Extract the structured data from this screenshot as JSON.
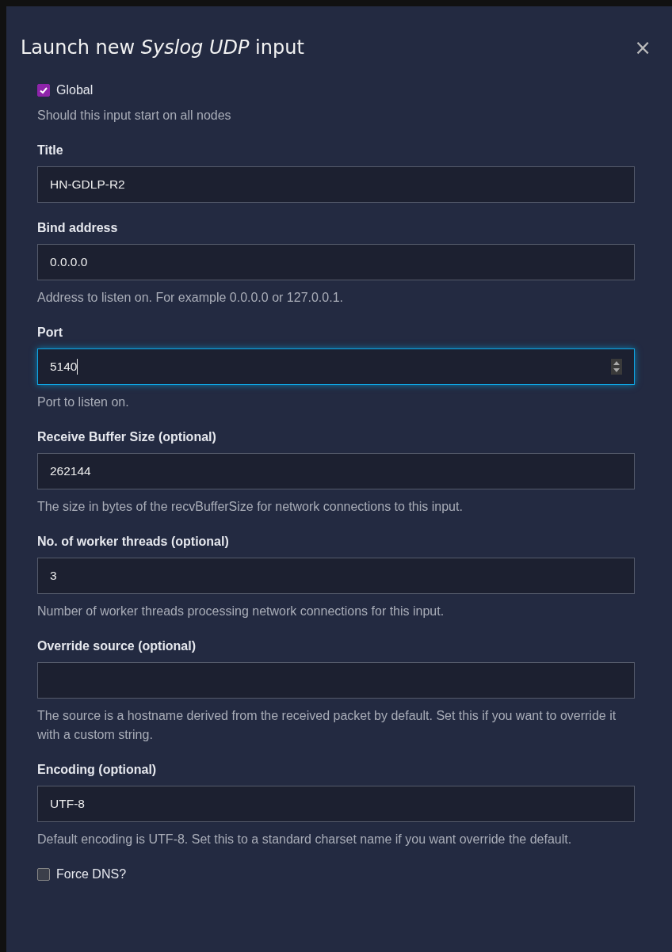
{
  "dialog": {
    "title": "Launch new *Syslog UDP* input",
    "close": "×"
  },
  "fields": [
    {
      "kind": "checkbox",
      "label": "Global",
      "checked": true,
      "help": "Should this input start on all nodes"
    },
    {
      "kind": "text",
      "label": "Title",
      "value": "HN-GDLP-R2",
      "focused": false
    },
    {
      "kind": "text",
      "label": "Bind address",
      "value": "0.0.0.0",
      "focused": false,
      "help": "Address to listen on. For example 0.0.0.0 or 127.0.0.1."
    },
    {
      "kind": "number",
      "label": "Port",
      "value": "5140",
      "focused": true,
      "help": "Port to listen on."
    },
    {
      "kind": "text",
      "label": "Receive Buffer Size (optional)",
      "value": "262144",
      "focused": false,
      "help": "The size in bytes of the recvBufferSize for network connections to this input."
    },
    {
      "kind": "text",
      "label": "No. of worker threads (optional)",
      "value": "3",
      "focused": false,
      "help": "Number of worker threads processing network connections for this input."
    },
    {
      "kind": "text",
      "label": "Override source (optional)",
      "focused": false,
      "help": "The source is a hostname derived from the received packet by default. Set this if you want to override it with a custom string."
    },
    {
      "kind": "text",
      "label": "Encoding (optional)",
      "value": "UTF-8",
      "focused": false,
      "help": "Default encoding is UTF-8. Set this to a standard charset name if you want override the default."
    },
    {
      "kind": "checkbox",
      "label": "Force DNS?",
      "checked": false
    }
  ]
}
